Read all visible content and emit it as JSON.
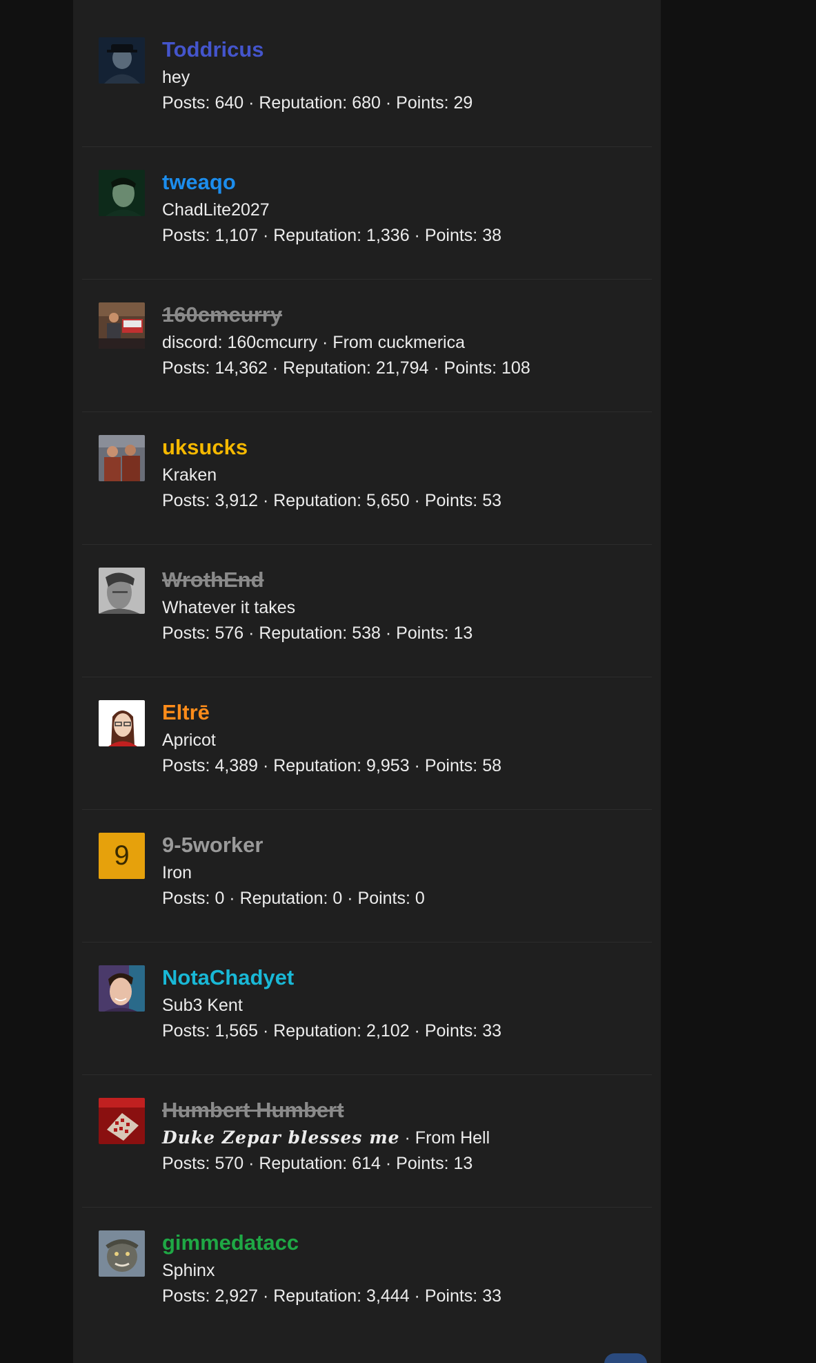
{
  "members": [
    {
      "name": "Toddricus",
      "name_color": "#4455cc",
      "banned": false,
      "title": "hey",
      "title_suffix": "",
      "stats": {
        "posts_label": "Posts:",
        "posts": "640",
        "rep_label": "Reputation:",
        "reputation": "680",
        "points_label": "Points:",
        "points": "29"
      }
    },
    {
      "name": "tweaqo",
      "name_color": "#1c8ded",
      "banned": false,
      "title": "ChadLite2027",
      "title_suffix": "",
      "stats": {
        "posts_label": "Posts:",
        "posts": "1,107",
        "rep_label": "Reputation:",
        "reputation": "1,336",
        "points_label": "Points:",
        "points": "38"
      }
    },
    {
      "name": "160cmcurry",
      "name_color": "#8a8a8a",
      "banned": true,
      "title": "discord: 160cmcurry",
      "title_suffix": "From cuckmerica",
      "stats": {
        "posts_label": "Posts:",
        "posts": "14,362",
        "rep_label": "Reputation:",
        "reputation": "21,794",
        "points_label": "Points:",
        "points": "108"
      }
    },
    {
      "name": "uksucks",
      "name_color": "#f5b800",
      "banned": false,
      "title": "Kraken",
      "title_suffix": "",
      "stats": {
        "posts_label": "Posts:",
        "posts": "3,912",
        "rep_label": "Reputation:",
        "reputation": "5,650",
        "points_label": "Points:",
        "points": "53"
      }
    },
    {
      "name": "WrothEnd",
      "name_color": "#8a8a8a",
      "banned": true,
      "title": "Whatever it takes",
      "title_suffix": "",
      "stats": {
        "posts_label": "Posts:",
        "posts": "576",
        "rep_label": "Reputation:",
        "reputation": "538",
        "points_label": "Points:",
        "points": "13"
      }
    },
    {
      "name": "Eltrē",
      "name_color": "#ff8c1a",
      "banned": false,
      "title": "Apricot",
      "title_suffix": "",
      "stats": {
        "posts_label": "Posts:",
        "posts": "4,389",
        "rep_label": "Reputation:",
        "reputation": "9,953",
        "points_label": "Points:",
        "points": "58"
      }
    },
    {
      "name": "9-5worker",
      "name_color": "#9a9a9a",
      "banned": false,
      "avatar_letter": "9",
      "title": "Iron",
      "title_suffix": "",
      "stats": {
        "posts_label": "Posts:",
        "posts": "0",
        "rep_label": "Reputation:",
        "reputation": "0",
        "points_label": "Points:",
        "points": "0"
      }
    },
    {
      "name": "NotaChadyet",
      "name_color": "#19b8d6",
      "banned": false,
      "title": "Sub3 Kent",
      "title_suffix": "",
      "stats": {
        "posts_label": "Posts:",
        "posts": "1,565",
        "rep_label": "Reputation:",
        "reputation": "2,102",
        "points_label": "Points:",
        "points": "33"
      }
    },
    {
      "name": "Humbert Humbert",
      "name_color": "#8a8a8a",
      "banned": true,
      "title": "Duke Zepar blesses me",
      "title_suffix": "From Hell",
      "stats": {
        "posts_label": "Posts:",
        "posts": "570",
        "rep_label": "Reputation:",
        "reputation": "614",
        "points_label": "Points:",
        "points": "13"
      }
    },
    {
      "name": "gimmedatacc",
      "name_color": "#1fa845",
      "banned": false,
      "title": "Sphinx",
      "title_suffix": "",
      "stats": {
        "posts_label": "Posts:",
        "posts": "2,927",
        "rep_label": "Reputation:",
        "reputation": "3,444",
        "points_label": "Points:",
        "points": "33"
      }
    }
  ],
  "separator": " · "
}
